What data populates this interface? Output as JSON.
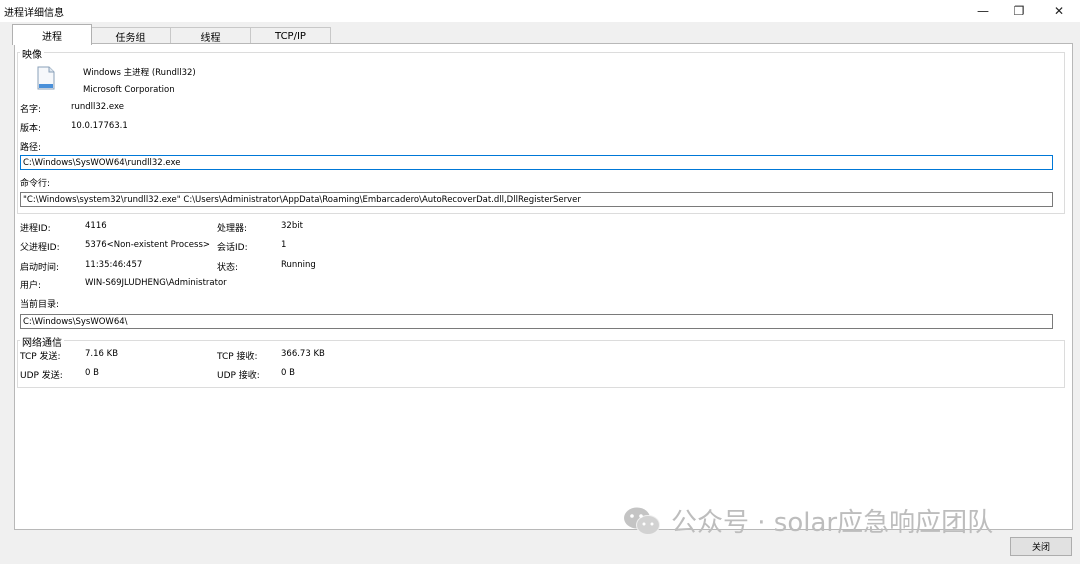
{
  "window": {
    "title": "进程详细信息",
    "min_glyph": "—",
    "max_glyph": "❐",
    "close_glyph": "✕"
  },
  "tabs": [
    {
      "label": "进程",
      "active": true
    },
    {
      "label": "任务组",
      "active": false
    },
    {
      "label": "线程",
      "active": false
    },
    {
      "label": "TCP/IP",
      "active": false
    }
  ],
  "image_group": {
    "legend": "映像",
    "icon": "document-icon",
    "description": "Windows 主进程 (Rundll32)",
    "company": "Microsoft Corporation",
    "name_label": "名字:",
    "name_value": "rundll32.exe",
    "version_label": "版本:",
    "version_value": "10.0.17763.1",
    "path_label": "路径:",
    "path_value": "C:\\Windows\\SysWOW64\\rundll32.exe",
    "cmdline_label": "命令行:",
    "cmdline_value": "\"C:\\Windows\\system32\\rundll32.exe\"  C:\\Users\\Administrator\\AppData\\Roaming\\Embarcadero\\AutoRecoverDat.dll,DllRegisterServer"
  },
  "process_info": {
    "pid_label": "进程ID:",
    "pid_value": "4116",
    "arch_label": "处理器:",
    "arch_value": "32bit",
    "ppid_label": "父进程ID:",
    "ppid_value": "5376<Non-existent Process>",
    "session_label": "会话ID:",
    "session_value": "1",
    "start_label": "启动时间:",
    "start_value": "11:35:46:457",
    "state_label": "状态:",
    "state_value": "Running",
    "user_label": "用户:",
    "user_value": "WIN-S69JLUDHENG\\Administrator",
    "cwd_label": "当前目录:",
    "cwd_value": "C:\\Windows\\SysWOW64\\"
  },
  "network_group": {
    "legend": "网络通信",
    "tcp_send_label": "TCP 发送:",
    "tcp_send_value": "7.16 KB",
    "tcp_recv_label": "TCP 接收:",
    "tcp_recv_value": "366.73 KB",
    "udp_send_label": "UDP 发送:",
    "udp_send_value": "0 B",
    "udp_recv_label": "UDP 接收:",
    "udp_recv_value": "0 B"
  },
  "footer": {
    "close_label": "关闭"
  },
  "watermark": {
    "text": "公众号 · solar应急响应团队",
    "icon": "wechat-icon"
  },
  "colors": {
    "focus_border": "#0078d7",
    "panel_bg": "#ffffff",
    "window_bg": "#f0f0f0"
  }
}
